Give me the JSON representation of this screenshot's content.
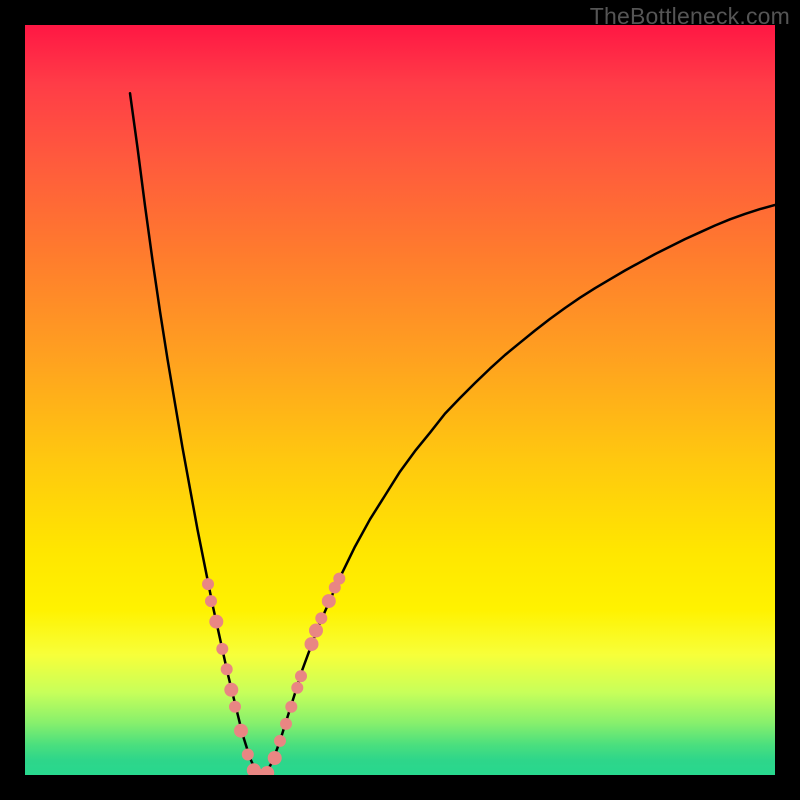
{
  "watermark": {
    "text": "TheBottleneck.com"
  },
  "chart_data": {
    "type": "line",
    "title": "",
    "xlabel": "",
    "ylabel": "",
    "xlim": [
      0,
      100
    ],
    "ylim": [
      0,
      110
    ],
    "curve": [
      {
        "x": 14.0,
        "y": 100.0
      },
      {
        "x": 15.0,
        "y": 92.0
      },
      {
        "x": 16.0,
        "y": 83.5
      },
      {
        "x": 17.0,
        "y": 75.5
      },
      {
        "x": 18.0,
        "y": 68.0
      },
      {
        "x": 19.0,
        "y": 61.0
      },
      {
        "x": 20.0,
        "y": 54.5
      },
      {
        "x": 21.0,
        "y": 48.0
      },
      {
        "x": 22.0,
        "y": 42.0
      },
      {
        "x": 23.0,
        "y": 36.0
      },
      {
        "x": 24.0,
        "y": 30.5
      },
      {
        "x": 25.0,
        "y": 25.0
      },
      {
        "x": 26.0,
        "y": 20.0
      },
      {
        "x": 27.0,
        "y": 15.0
      },
      {
        "x": 28.0,
        "y": 10.5
      },
      {
        "x": 29.0,
        "y": 6.0
      },
      {
        "x": 30.0,
        "y": 2.5
      },
      {
        "x": 31.0,
        "y": 0.0
      },
      {
        "x": 32.0,
        "y": 0.0
      },
      {
        "x": 33.0,
        "y": 2.0
      },
      {
        "x": 34.0,
        "y": 5.0
      },
      {
        "x": 35.0,
        "y": 8.5
      },
      {
        "x": 36.0,
        "y": 12.0
      },
      {
        "x": 37.0,
        "y": 15.5
      },
      {
        "x": 38.0,
        "y": 18.5
      },
      {
        "x": 39.0,
        "y": 21.5
      },
      {
        "x": 40.0,
        "y": 24.0
      },
      {
        "x": 42.0,
        "y": 29.0
      },
      {
        "x": 44.0,
        "y": 33.5
      },
      {
        "x": 46.0,
        "y": 37.5
      },
      {
        "x": 48.0,
        "y": 41.0
      },
      {
        "x": 50.0,
        "y": 44.5
      },
      {
        "x": 52.0,
        "y": 47.5
      },
      {
        "x": 54.0,
        "y": 50.2
      },
      {
        "x": 56.0,
        "y": 53.0
      },
      {
        "x": 58.0,
        "y": 55.3
      },
      {
        "x": 60.0,
        "y": 57.5
      },
      {
        "x": 62.0,
        "y": 59.6
      },
      {
        "x": 64.0,
        "y": 61.6
      },
      {
        "x": 66.0,
        "y": 63.4
      },
      {
        "x": 68.0,
        "y": 65.2
      },
      {
        "x": 70.0,
        "y": 66.9
      },
      {
        "x": 72.0,
        "y": 68.5
      },
      {
        "x": 74.0,
        "y": 70.0
      },
      {
        "x": 76.0,
        "y": 71.4
      },
      {
        "x": 78.0,
        "y": 72.7
      },
      {
        "x": 80.0,
        "y": 74.0
      },
      {
        "x": 82.0,
        "y": 75.2
      },
      {
        "x": 84.0,
        "y": 76.4
      },
      {
        "x": 86.0,
        "y": 77.5
      },
      {
        "x": 88.0,
        "y": 78.6
      },
      {
        "x": 90.0,
        "y": 79.6
      },
      {
        "x": 92.0,
        "y": 80.6
      },
      {
        "x": 94.0,
        "y": 81.5
      },
      {
        "x": 96.0,
        "y": 82.3
      },
      {
        "x": 98.0,
        "y": 83.0
      },
      {
        "x": 100.0,
        "y": 83.6
      }
    ],
    "markers": [
      {
        "x": 24.4,
        "y": 28.0,
        "r": 6
      },
      {
        "x": 24.8,
        "y": 25.5,
        "r": 6
      },
      {
        "x": 25.5,
        "y": 22.5,
        "r": 7
      },
      {
        "x": 26.3,
        "y": 18.5,
        "r": 6
      },
      {
        "x": 26.9,
        "y": 15.5,
        "r": 6
      },
      {
        "x": 27.5,
        "y": 12.5,
        "r": 7
      },
      {
        "x": 28.0,
        "y": 10.0,
        "r": 6
      },
      {
        "x": 28.8,
        "y": 6.5,
        "r": 7
      },
      {
        "x": 29.7,
        "y": 3.0,
        "r": 6
      },
      {
        "x": 30.5,
        "y": 0.7,
        "r": 7
      },
      {
        "x": 31.3,
        "y": 0.0,
        "r": 6
      },
      {
        "x": 32.3,
        "y": 0.3,
        "r": 7
      },
      {
        "x": 33.3,
        "y": 2.5,
        "r": 7
      },
      {
        "x": 34.0,
        "y": 5.0,
        "r": 6
      },
      {
        "x": 34.8,
        "y": 7.5,
        "r": 6
      },
      {
        "x": 35.5,
        "y": 10.0,
        "r": 6
      },
      {
        "x": 36.3,
        "y": 12.8,
        "r": 6
      },
      {
        "x": 36.8,
        "y": 14.5,
        "r": 6
      },
      {
        "x": 38.2,
        "y": 19.2,
        "r": 7
      },
      {
        "x": 38.8,
        "y": 21.2,
        "r": 7
      },
      {
        "x": 39.5,
        "y": 23.0,
        "r": 6
      },
      {
        "x": 40.5,
        "y": 25.5,
        "r": 7
      },
      {
        "x": 41.3,
        "y": 27.5,
        "r": 6
      },
      {
        "x": 41.9,
        "y": 28.8,
        "r": 6
      }
    ]
  }
}
